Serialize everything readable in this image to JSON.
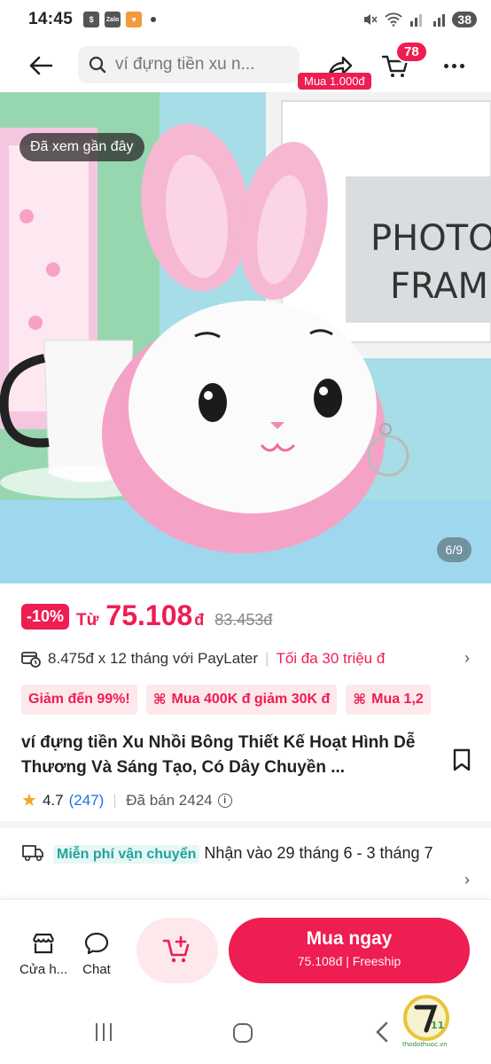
{
  "status": {
    "time": "14:45",
    "battery": "38"
  },
  "search": {
    "placeholder": "ví đựng tiền xu n..."
  },
  "cart": {
    "count": "78",
    "buy_tag": "Mua 1.000đ"
  },
  "image": {
    "recent_label": "Đã xem gần đây",
    "page_indicator": "6/9",
    "photo_text_line1": "PHOTO",
    "photo_text_line2": "FRAME"
  },
  "price": {
    "discount": "-10%",
    "from": "Từ",
    "value": "75.108",
    "unit": "đ",
    "old": "83.453đ"
  },
  "paylater": {
    "text": "8.475đ x 12 tháng với PayLater",
    "limit": "Tối đa 30 triệu đ"
  },
  "coupons": [
    "Giảm đến 99%!",
    "Mua 400K đ giảm 30K đ",
    "Mua 1,2"
  ],
  "product": {
    "title": "ví đựng tiền Xu Nhồi Bông Thiết Kế Hoạt Hình Dễ Thương Và Sáng Tạo, Có Dây Chuyền ...",
    "rating": "4.7",
    "reviews": "(247)",
    "sold": "Đã bán 2424"
  },
  "shipping": {
    "free_label": "Miễn phí vận chuyển",
    "delivery": "Nhận vào 29 tháng 6 - 3 tháng 7"
  },
  "actions": {
    "store": "Cửa h...",
    "chat": "Chat",
    "buy_main": "Mua ngay",
    "buy_sub": "75.108đ | Freeship"
  },
  "watermark": {
    "text": "thodothuoc.vn"
  },
  "colors": {
    "accent": "#ee1d52",
    "teal": "#20a39e",
    "star": "#f5a623"
  }
}
